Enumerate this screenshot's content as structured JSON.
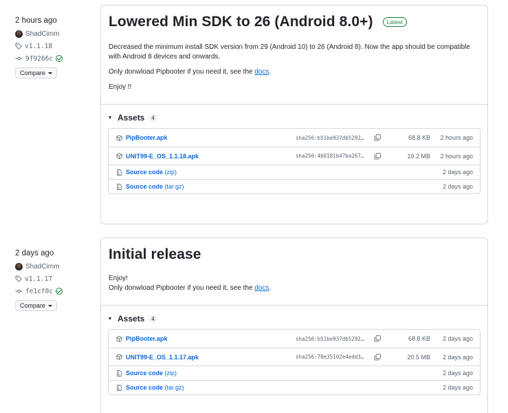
{
  "releases": [
    {
      "time_ago": "2 hours ago",
      "author": "ShadCimm",
      "tag": "v1.1.18",
      "commit": "9f9266c",
      "compare_label": "Compare",
      "title": "Lowered Min SDK to 26 (Android 8.0+)",
      "badge": "Latest",
      "body_p1": "Decreased the minimum install SDK version from 29 (Android 10) to 26 (Android 8). Now the app should be compatible with Android 8 devices and onwards.",
      "body_p2_prefix": "Only donwload Pipbooter if you need it, see the ",
      "body_link": "docs",
      "body_p2_suffix": ".",
      "body_p3": "Enjoy !!",
      "assets_label": "Assets",
      "assets_count": "4",
      "assets": [
        {
          "name": "PipBooter.apk",
          "sha": "sha256:b51be937db5292…",
          "size": "68.8 KB",
          "date": "2 hours ago"
        },
        {
          "name": "UNIT99-E_OS_1.1.18.apk",
          "sha": "sha256:4b0181b47ba267…",
          "size": "19.2 MB",
          "date": "2 hours ago"
        },
        {
          "name": "Source code",
          "sub": "(zip)",
          "date": "2 days ago"
        },
        {
          "name": "Source code",
          "sub": "(tar.gz)",
          "date": "2 days ago"
        }
      ]
    },
    {
      "time_ago": "2 days ago",
      "author": "ShadCimm",
      "tag": "v1.1.17",
      "commit": "fe1cf0c",
      "compare_label": "Compare",
      "title": "Initial release",
      "body_p1": "Enjoy!",
      "body_p2_prefix": "Only donwload Pipbooter if you need it, see the ",
      "body_link": "docs",
      "body_p2_suffix": ".",
      "assets_label": "Assets",
      "assets_count": "4",
      "assets": [
        {
          "name": "PipBooter.apk",
          "sha": "sha256:b51be937db5292…",
          "size": "68.8 KB",
          "date": "2 days ago"
        },
        {
          "name": "UNIT99-E_OS_1.1.17.apk",
          "sha": "sha256:70e35102e4edd3…",
          "size": "20.5 MB",
          "date": "2 days ago"
        },
        {
          "name": "Source code",
          "sub": "(zip)",
          "date": "2 days ago"
        },
        {
          "name": "Source code",
          "sub": "(tar.gz)",
          "date": "2 days ago"
        }
      ]
    }
  ],
  "icons": {
    "avatar": "user-avatar",
    "tag": "tag-icon",
    "commit": "git-commit-icon",
    "verified": "verified-check-icon",
    "package": "package-icon",
    "archive": "file-zip-icon",
    "copy": "copy-icon"
  },
  "colors": {
    "link": "#0969da",
    "latest": "#1a7f37",
    "border": "#d1d9e0"
  }
}
